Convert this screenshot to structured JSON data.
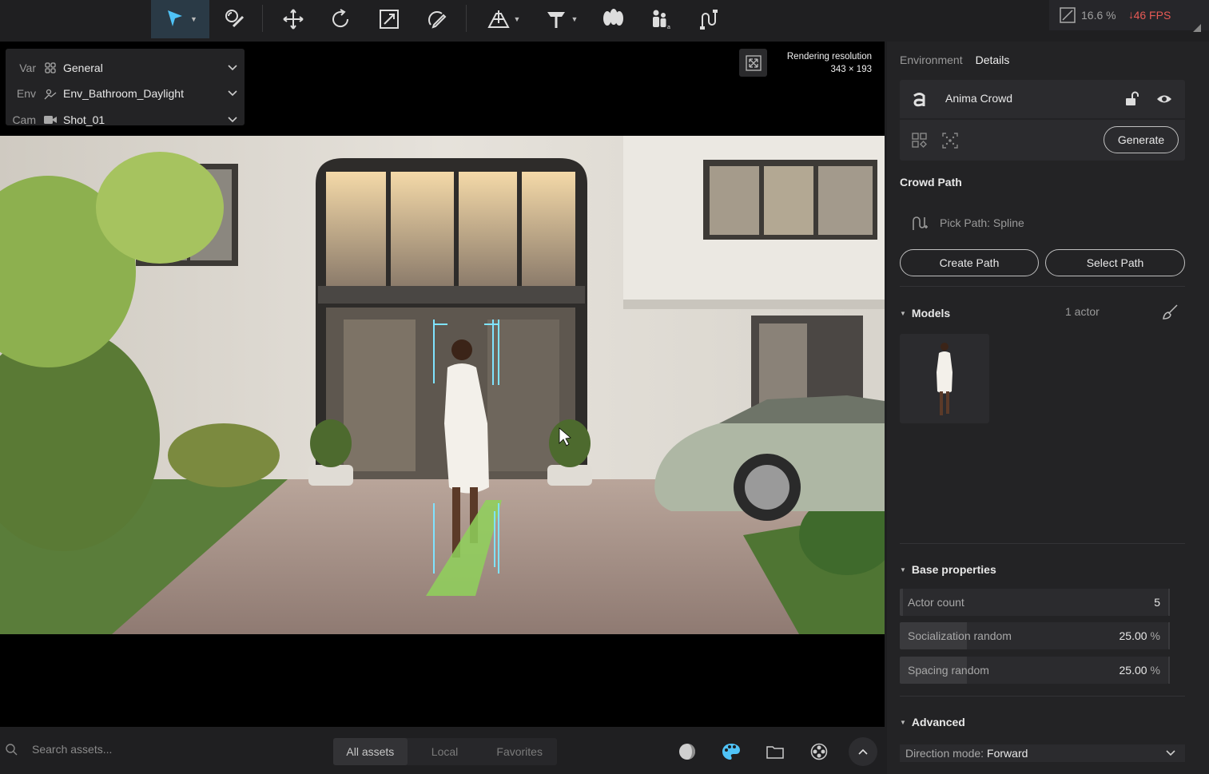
{
  "toolbar": {
    "tools": [
      {
        "name": "select-tool",
        "icon": "cursor-arrow-icon",
        "active": true,
        "has_menu": true
      },
      {
        "name": "paint-tool",
        "icon": "brush-sphere-icon"
      },
      {
        "name": "move-tool",
        "icon": "move-arrows-icon"
      },
      {
        "name": "rotate-tool",
        "icon": "rotate-icon"
      },
      {
        "name": "scale-tool",
        "icon": "scale-icon"
      },
      {
        "name": "snap-tool",
        "icon": "snap-pencil-icon"
      },
      {
        "name": "placement-tool",
        "icon": "place-ground-icon",
        "has_menu": true
      },
      {
        "name": "scatter-tool",
        "icon": "scatter-icon",
        "has_menu": true
      },
      {
        "name": "vegetation-tool",
        "icon": "trees-icon"
      },
      {
        "name": "crowd-tool",
        "icon": "people-icon"
      },
      {
        "name": "path-tool",
        "icon": "path-icon"
      }
    ],
    "perf": {
      "scale": "16.6 %",
      "fps": "46 FPS",
      "fps_color": "#e75a55"
    }
  },
  "viewport": {
    "selectors": [
      {
        "label": "Var",
        "value": "General",
        "icon": "variation-grid-icon"
      },
      {
        "label": "Env",
        "value": "Env_Bathroom_Daylight",
        "icon": "environment-sun-icon"
      },
      {
        "label": "Cam",
        "value": "Shot_01",
        "icon": "camera-icon"
      }
    ],
    "rendering_label": "Rendering resolution",
    "rendering_value": "343 × 193"
  },
  "assetbar": {
    "search_placeholder": "Search assets...",
    "filters": [
      "All assets",
      "Local",
      "Favorites"
    ],
    "active_filter": "All assets"
  },
  "panel": {
    "tabs": [
      "Environment",
      "Details"
    ],
    "active_tab": "Details",
    "object_name": "Anima Crowd",
    "generate_label": "Generate",
    "crowd_path_title": "Crowd Path",
    "pick_path_label": "Pick Path: Spline",
    "create_path_label": "Create Path",
    "select_path_label": "Select Path",
    "models_title": "Models",
    "models_count": "1 actor",
    "base_title": "Base properties",
    "props": [
      {
        "label": "Actor count",
        "value": "5",
        "unit": "",
        "fill_fraction": 0.0
      },
      {
        "label": "Socialization random",
        "value": "25.00",
        "unit": "%",
        "fill_fraction": 0.25
      },
      {
        "label": "Spacing random",
        "value": "25.00",
        "unit": "%",
        "fill_fraction": 0.25
      }
    ],
    "advanced_title": "Advanced",
    "direction_label": "Direction mode:",
    "direction_value": "Forward"
  },
  "colors": {
    "accent": "#4fc3f7",
    "active_tool_bg": "#2a3a46",
    "path_green": "#8fd15a"
  }
}
